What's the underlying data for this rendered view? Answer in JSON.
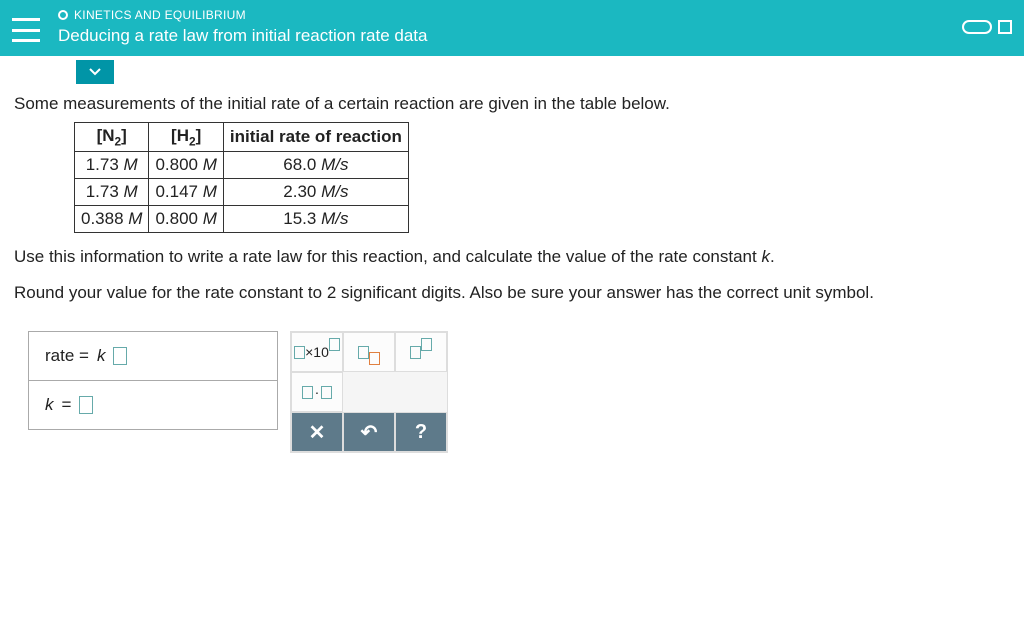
{
  "header": {
    "category": "KINETICS AND EQUILIBRIUM",
    "title": "Deducing a rate law from initial reaction rate data"
  },
  "prompt_intro": "Some measurements of the initial rate of a certain reaction are given in the table below.",
  "table": {
    "headers": {
      "col1_species": "N",
      "col1_sub": "2",
      "col2_species": "H",
      "col2_sub": "2",
      "col3": "initial rate of reaction"
    },
    "rows": [
      {
        "n2": "1.73",
        "h2": "0.800",
        "rate": "68.0"
      },
      {
        "n2": "1.73",
        "h2": "0.147",
        "rate": "2.30"
      },
      {
        "n2": "0.388",
        "h2": "0.800",
        "rate": "15.3"
      }
    ],
    "conc_unit": "M",
    "rate_unit": "M/s"
  },
  "prompt_task": "Use this information to write a rate law for this reaction, and calculate the value of the rate constant ",
  "rate_constant_symbol": "k",
  "period": ".",
  "prompt_round_a": "Round your value for the rate constant to ",
  "sigfigs": "2",
  "prompt_round_b": " significant digits. Also be sure your answer has the correct unit symbol.",
  "answers": {
    "rate_label_prefix": "rate = ",
    "k_label_prefix": "k = "
  },
  "palette": {
    "sci_x10": "×10",
    "dot": "·",
    "clear": "✕",
    "undo": "↶",
    "help": "?"
  }
}
